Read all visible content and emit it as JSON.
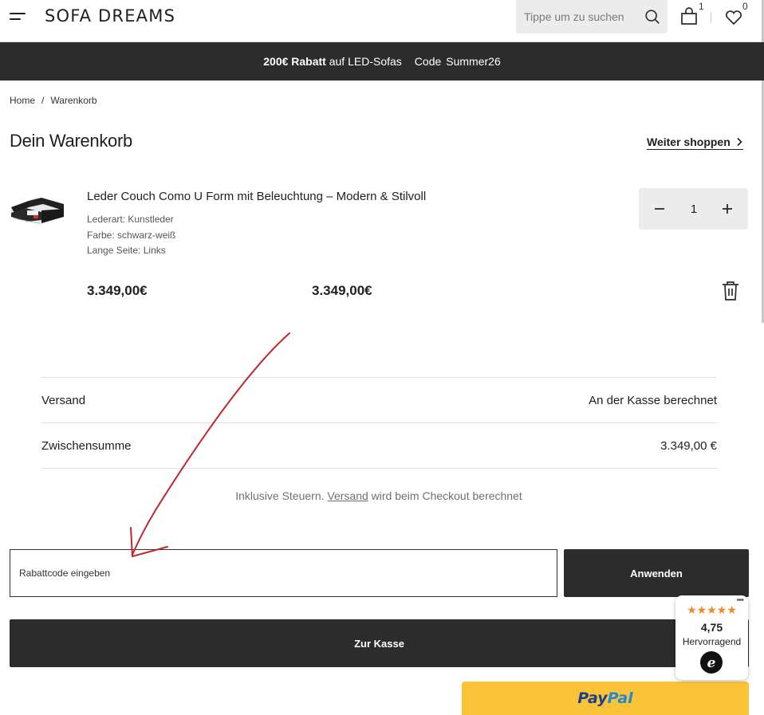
{
  "header": {
    "logo": "SOFA DREAMS",
    "search_placeholder": "Tippe um zu suchen",
    "cart_count": "1",
    "wishlist_count": "0"
  },
  "promo": {
    "bold": "200€ Rabatt",
    "text": "auf LED-Sofas",
    "code_label": "Code",
    "code": "Summer26"
  },
  "breadcrumb": {
    "home": "Home",
    "separator": "/",
    "current": "Warenkorb"
  },
  "page": {
    "title": "Dein Warenkorb",
    "continue_shopping": "Weiter shoppen"
  },
  "cart_item": {
    "title": "Leder Couch Como U Form mit Beleuchtung – Modern & Stilvoll",
    "attributes": [
      "Lederart: Kunstleder",
      "Farbe: schwarz-weiß",
      "Lange Seite: Links"
    ],
    "unit_price": "3.349,00€",
    "line_total": "3.349,00€",
    "quantity": "1"
  },
  "totals": {
    "shipping_label": "Versand",
    "shipping_value": "An der Kasse berechnet",
    "subtotal_label": "Zwischensumme",
    "subtotal_value": "3.349,00 €",
    "tax_note_pre": "Inklusive Steuern.",
    "tax_note_link": "Versand",
    "tax_note_post": "wird beim Checkout berechnet"
  },
  "discount": {
    "placeholder": "Rabattcode eingeben",
    "apply_label": "Anwenden"
  },
  "checkout": {
    "label": "Zur Kasse",
    "paypal_part1": "Pay",
    "paypal_part2": "Pal"
  },
  "trust_badge": {
    "stars": "★★★★★",
    "score": "4,75",
    "label": "Hervorragend",
    "dots": "•••"
  },
  "colors": {
    "dark": "#2c2c2c",
    "paypal_yellow": "#fbc438",
    "star": "#f08b1f",
    "annotation_arrow": "#c0272d"
  }
}
